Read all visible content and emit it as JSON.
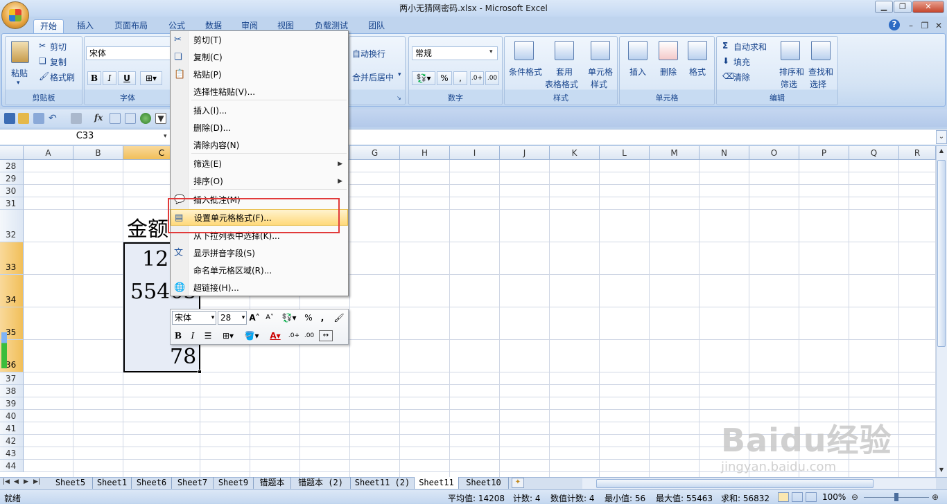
{
  "window": {
    "title": "两小无猜网密码.xlsx - Microsoft Excel",
    "minimize": "▁",
    "restore": "❐",
    "close": "✕"
  },
  "tabs": [
    "开始",
    "插入",
    "页面布局",
    "公式",
    "数据",
    "审阅",
    "视图",
    "负载测试",
    "团队"
  ],
  "ribbon": {
    "clipboard": {
      "paste": "粘贴",
      "cut": "剪切",
      "copy": "复制",
      "format_painter": "格式刷",
      "label": "剪贴板"
    },
    "font": {
      "font_name": "宋体",
      "bold": "B",
      "italic": "I",
      "underline": "U",
      "label": "字体"
    },
    "alignment": {
      "wrap": "自动换行",
      "merge": "合并后居中"
    },
    "number": {
      "format": "常规",
      "percent": "%",
      "comma": ",",
      "label": "数字"
    },
    "styles": {
      "conditional": "条件格式",
      "table1": "套用",
      "table2": "表格格式",
      "cell1": "单元格",
      "cell2": "样式",
      "label": "样式"
    },
    "cells": {
      "insert": "插入",
      "delete": "删除",
      "format": "格式",
      "label": "单元格"
    },
    "editing": {
      "autosum": "自动求和",
      "fill": "填充",
      "clear": "清除",
      "sort1": "排序和",
      "sort2": "筛选",
      "find1": "查找和",
      "find2": "选择",
      "label": "编辑"
    }
  },
  "formula_bar": {
    "name_box": "C33"
  },
  "columns": [
    "A",
    "B",
    "C",
    "D",
    "E",
    "F",
    "G",
    "H",
    "I",
    "J",
    "K",
    "L",
    "M",
    "N",
    "O",
    "P",
    "Q",
    "R"
  ],
  "rows": [
    "28",
    "29",
    "30",
    "31",
    "32",
    "33",
    "34",
    "35",
    "36",
    "37",
    "38",
    "39",
    "40",
    "41",
    "42",
    "43",
    "44"
  ],
  "cells": {
    "c32": "金额",
    "c33": "12",
    "c34": "55463",
    "c36": "78"
  },
  "context_menu": [
    {
      "label": "剪切(T)",
      "icon": "scissors-icon"
    },
    {
      "label": "复制(C)",
      "icon": "copy-icon"
    },
    {
      "label": "粘贴(P)",
      "icon": "paste-icon"
    },
    {
      "label": "选择性粘贴(V)...",
      "icon": ""
    },
    {
      "label": "插入(I)...",
      "icon": ""
    },
    {
      "label": "删除(D)...",
      "icon": ""
    },
    {
      "label": "清除内容(N)",
      "icon": ""
    },
    {
      "label": "筛选(E)",
      "icon": "",
      "submenu": "▶"
    },
    {
      "label": "排序(O)",
      "icon": "",
      "submenu": "▶"
    },
    {
      "label": "插入批注(M)",
      "icon": "comment-icon"
    },
    {
      "label": "设置单元格格式(F)...",
      "icon": "format-cells-icon"
    },
    {
      "label": "从下拉列表中选择(K)...",
      "icon": ""
    },
    {
      "label": "显示拼音字段(S)",
      "icon": "pinyin-icon"
    },
    {
      "label": "命名单元格区域(R)...",
      "icon": ""
    },
    {
      "label": "超链接(H)...",
      "icon": "hyperlink-icon"
    }
  ],
  "mini_toolbar": {
    "font": "宋体",
    "size": "28",
    "bold": "B",
    "italic": "I",
    "percent": "%",
    "comma": ","
  },
  "sheet_tabs": [
    "Sheet5",
    "Sheet1",
    "Sheet6",
    "Sheet7",
    "Sheet9",
    "错题本",
    "错题本 (2)",
    "Sheet11 (2)",
    "Sheet11",
    "Sheet10"
  ],
  "active_sheet": "Sheet11",
  "status": {
    "ready": "就绪",
    "average": "平均值: 14208",
    "count": "计数: 4",
    "numcount": "数值计数: 4",
    "min": "最小值: 56",
    "max": "最大值: 55463",
    "sum": "求和: 56832",
    "zoom": "100%"
  },
  "watermark": {
    "brand": "Baidu经验",
    "url": "jingyan.baidu.com"
  }
}
